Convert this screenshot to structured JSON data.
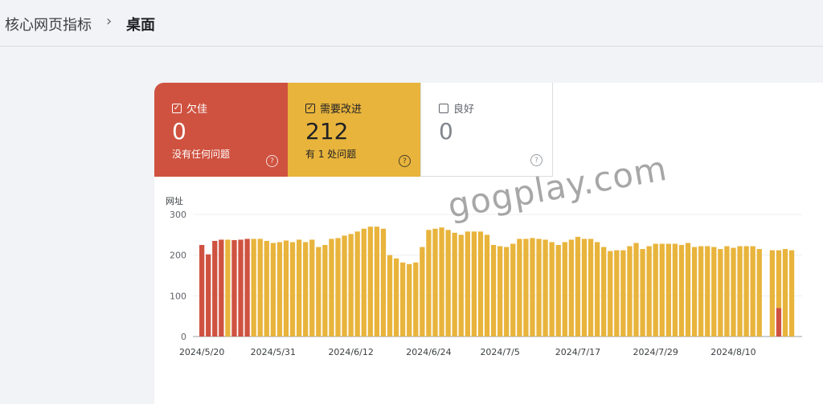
{
  "breadcrumb": {
    "parent": "核心网页指标",
    "current": "桌面"
  },
  "tiles": {
    "poor": {
      "label": "欠佳",
      "value": "0",
      "sub": "没有任何问题",
      "checked": true
    },
    "needs_improvement": {
      "label": "需要改进",
      "value": "212",
      "sub": "有 1 处问题",
      "checked": true
    },
    "good": {
      "label": "良好",
      "value": "0",
      "sub": "",
      "checked": false
    }
  },
  "watermark": "gogplay.com",
  "colors": {
    "poor": "#cf5240",
    "needs_improvement": "#e8b43c",
    "good": "#ffffff"
  },
  "chart_data": {
    "type": "bar",
    "stacked": true,
    "ylabel": "网址",
    "ylim": [
      0,
      300
    ],
    "yticks": [
      0,
      100,
      200,
      300
    ],
    "xtick_labels": [
      "2024/5/20",
      "2024/5/31",
      "2024/6/12",
      "2024/6/24",
      "2024/7/5",
      "2024/7/17",
      "2024/7/29",
      "2024/8/10"
    ],
    "grid": true,
    "series": [
      {
        "name": "欠佳",
        "color": "#cf5240",
        "values": [
          225,
          202,
          235,
          238,
          0,
          237,
          238,
          240,
          0,
          0,
          0,
          0,
          0,
          0,
          0,
          0,
          0,
          0,
          0,
          0,
          0,
          0,
          0,
          0,
          0,
          0,
          0,
          0,
          0,
          0,
          0,
          0,
          0,
          0,
          0,
          0,
          0,
          0,
          0,
          0,
          0,
          0,
          0,
          0,
          0,
          0,
          0,
          0,
          0,
          0,
          0,
          0,
          0,
          0,
          0,
          0,
          0,
          0,
          0,
          0,
          0,
          0,
          0,
          0,
          0,
          0,
          0,
          0,
          0,
          0,
          0,
          0,
          0,
          0,
          0,
          0,
          0,
          0,
          0,
          0,
          0,
          0,
          0,
          0,
          0,
          0,
          0,
          0,
          0,
          70,
          0,
          0
        ]
      },
      {
        "name": "需要改进",
        "color": "#e8b43c",
        "values": [
          0,
          0,
          0,
          0,
          238,
          0,
          0,
          0,
          240,
          240,
          235,
          230,
          232,
          236,
          232,
          238,
          232,
          238,
          220,
          225,
          240,
          242,
          248,
          252,
          258,
          265,
          270,
          270,
          265,
          200,
          192,
          182,
          178,
          182,
          220,
          262,
          265,
          268,
          262,
          255,
          250,
          258,
          258,
          258,
          250,
          225,
          222,
          220,
          228,
          240,
          240,
          242,
          240,
          238,
          232,
          225,
          232,
          238,
          245,
          240,
          240,
          232,
          220,
          210,
          212,
          212,
          222,
          230,
          215,
          222,
          228,
          228,
          228,
          228,
          225,
          230,
          220,
          222,
          222,
          220,
          215,
          222,
          218,
          222,
          222,
          222,
          215,
          0,
          212,
          142,
          215,
          212
        ]
      }
    ]
  }
}
